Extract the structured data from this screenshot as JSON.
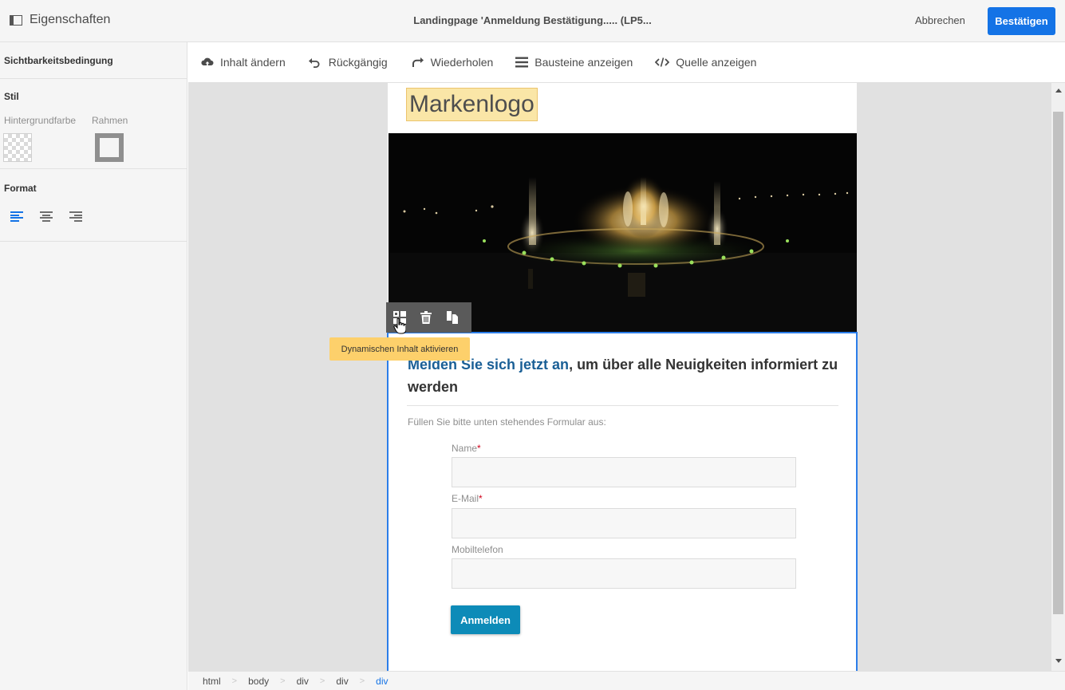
{
  "header": {
    "properties_label": "Eigenschaften",
    "title": "Landingpage 'Anmeldung Bestätigung..... (LP5...",
    "cancel_label": "Abbrechen",
    "confirm_label": "Bestätigen"
  },
  "sidebar": {
    "visibility_label": "Sichtbarkeitsbedingung",
    "style_label": "Stil",
    "background_label": "Hintergrundfarbe",
    "border_label": "Rahmen",
    "format_label": "Format"
  },
  "toolbar": {
    "change_content": "Inhalt ändern",
    "undo": "Rückgängig",
    "redo": "Wiederholen",
    "show_blocks": "Bausteine anzeigen",
    "show_source": "Quelle anzeigen"
  },
  "page": {
    "logo": "Markenlogo",
    "headline_highlight": "Melden Sie sich jetzt an",
    "headline_rest": ", um über alle Neuigkeiten informiert zu werden",
    "intro": "Füllen Sie bitte unten stehendes Formular aus:",
    "fields": [
      {
        "label": "Name",
        "required": "*"
      },
      {
        "label": "E-Mail",
        "required": "*"
      },
      {
        "label": "Mobiltelefon",
        "required": ""
      }
    ],
    "submit_label": "Anmelden"
  },
  "block_toolbar": {
    "tooltip": "Dynamischen Inhalt aktivieren",
    "icons": [
      "dynamic-content-icon",
      "trash-icon",
      "duplicate-icon"
    ]
  },
  "breadcrumb": [
    "html",
    "body",
    "div",
    "div",
    "div"
  ],
  "colors": {
    "accent": "#1473e6",
    "selection_border": "#2b7de9",
    "tooltip": "#fdd06b",
    "submit_button": "#0d8bb8",
    "headline_link": "#1a5f96"
  }
}
